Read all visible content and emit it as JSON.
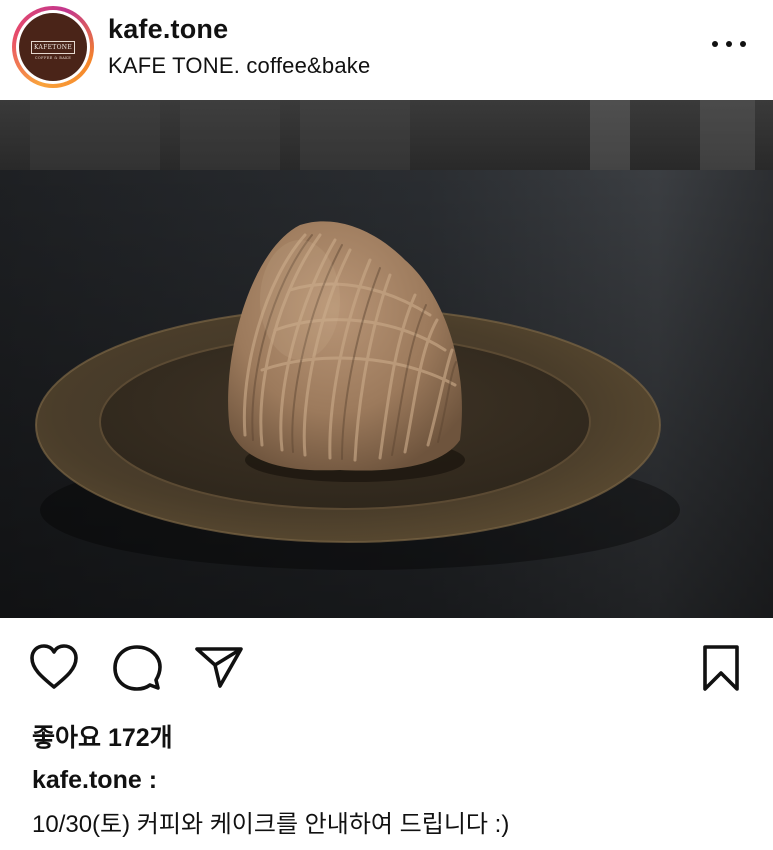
{
  "header": {
    "username": "kafe.tone",
    "subtitle": "KAFE TONE. coffee&bake",
    "avatar": {
      "logo_main": "KAFETONE",
      "logo_sub": "COFFEE & BAKE",
      "background_color": "#4a2418"
    },
    "more_icon": "more-horizontal-icon"
  },
  "photo": {
    "subject": "mont-blanc-cake-on-plate"
  },
  "actions": {
    "like_icon": "heart-icon",
    "comment_icon": "comment-icon",
    "share_icon": "send-icon",
    "save_icon": "bookmark-icon"
  },
  "likes": {
    "text": "좋아요 172개"
  },
  "caption": {
    "username": "kafe.tone :",
    "text": "10/30(토) 커피와 케이크를 안내하여 드립니다 :)"
  }
}
